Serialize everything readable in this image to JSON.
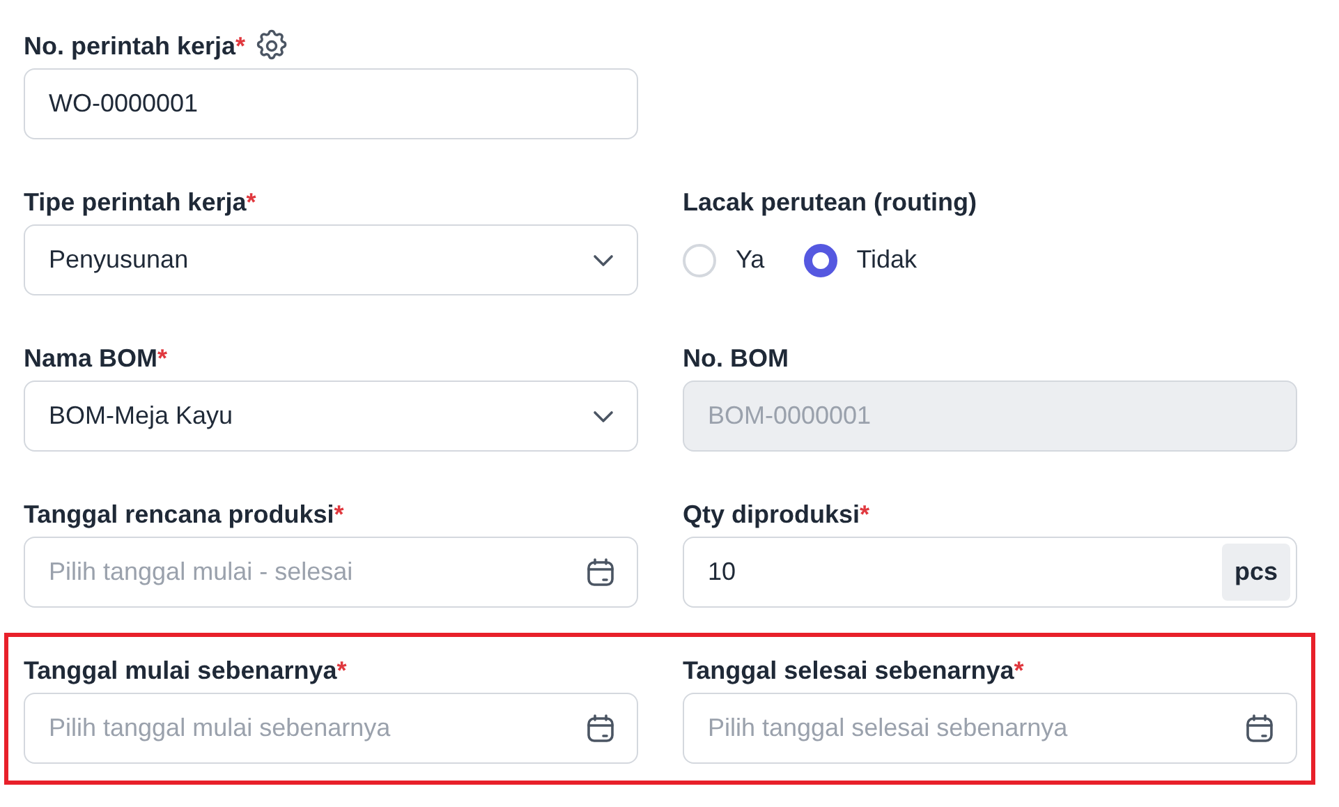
{
  "rows": [
    {
      "highlighted": false,
      "fields": [
        {
          "kind": "text",
          "label": "No. perintah kerja",
          "required_mark": "*",
          "has_settings": true,
          "value": "WO-0000001"
        }
      ]
    },
    {
      "highlighted": false,
      "fields": [
        {
          "kind": "select",
          "label": "Tipe perintah kerja",
          "required_mark": "*",
          "value": "Penyusunan"
        },
        {
          "kind": "radio",
          "label": "Lacak perutean (routing)",
          "options": [
            {
              "label": "Ya",
              "selected": false
            },
            {
              "label": "Tidak",
              "selected": true
            }
          ]
        }
      ]
    },
    {
      "highlighted": false,
      "fields": [
        {
          "kind": "select",
          "label": "Nama BOM",
          "required_mark": "*",
          "value": "BOM-Meja Kayu"
        },
        {
          "kind": "text",
          "label": "No. BOM",
          "disabled": true,
          "value": "BOM-0000001"
        }
      ]
    },
    {
      "highlighted": false,
      "fields": [
        {
          "kind": "date",
          "label": "Tanggal rencana produksi",
          "required_mark": "*",
          "placeholder": "Pilih tanggal mulai - selesai"
        },
        {
          "kind": "qty",
          "label": "Qty diproduksi",
          "required_mark": "*",
          "value": "10",
          "unit": "pcs"
        }
      ]
    },
    {
      "highlighted": true,
      "fields": [
        {
          "kind": "date",
          "label": "Tanggal mulai sebenarnya",
          "required_mark": "*",
          "placeholder": "Pilih tanggal mulai sebenarnya"
        },
        {
          "kind": "date",
          "label": "Tanggal selesai sebenarnya",
          "required_mark": "*",
          "placeholder": "Pilih tanggal selesai sebenarnya"
        }
      ]
    }
  ]
}
